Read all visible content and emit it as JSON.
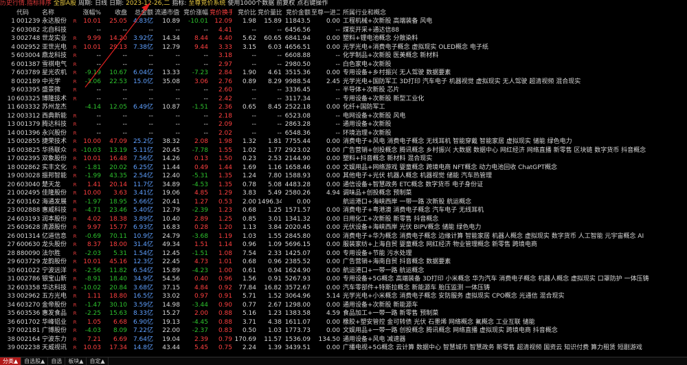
{
  "topbar": {
    "title": "历史行情.指标排序",
    "market": "全部A股",
    "period_label": "周期:",
    "period": "日线",
    "date_label": "日期:",
    "date": "2023-12-26,二",
    "indicator_label": "指标:",
    "indicator": "至尊竞价系统",
    "note1": "使用1000个数据",
    "note2": "前复权",
    "note3": "点右键操作"
  },
  "headers": {
    "code": "代码",
    "name": "名称",
    "chg": "涨幅%",
    "price": "收盘",
    "amt": "总金额",
    "cap": "流通市值亿",
    "bid": "竞价涨幅",
    "turn": "竞价换手↓",
    "ratio": "竞价比",
    "vr": "竞价量比",
    "bidamt": "竞价金额",
    "cont": "至尊一进二",
    "ind": "所属行业和概念"
  },
  "colors": {
    "up": "#ff4040",
    "down": "#2ec22e",
    "neutral": "#d8d8d8",
    "amount": "#5fa0ff",
    "accent": "#e8c840",
    "active_tab": "#b01818"
  },
  "rows": [
    {
      "idx": "1",
      "code": "001239",
      "name": "永达股份",
      "flag": "R",
      "chg": "10.01",
      "price": "25.05",
      "amt": "4.83亿",
      "cap": "10.89",
      "bid": "-10.01",
      "turn": "12.09",
      "ratio": "1.98",
      "vr": "15.89",
      "bidamt": "11843.5",
      "cont": "0.00",
      "ind": "工程机械+次新股 高端装备 风电"
    },
    {
      "idx": "2",
      "code": "603082",
      "name": "北自科技",
      "flag": "",
      "chg": "--",
      "price": "--",
      "amt": "--",
      "cap": "--",
      "bid": "--",
      "turn": "4.41",
      "ratio": "--",
      "vr": "--",
      "bidamt": "6456.56",
      "cont": "--",
      "ind": "煤炭开采+通达信88"
    },
    {
      "idx": "3",
      "code": "002748",
      "name": "世龙实业",
      "flag": "R",
      "chg": "9.99",
      "price": "14.20",
      "amt": "3.92亿",
      "cap": "14.34",
      "bid": "8.44",
      "turn": "4.40",
      "ratio": "5.62",
      "vr": "60.65",
      "bidamt": "6841.94",
      "cont": "0.00",
      "ind": "塑料+锂电池概念 分散染料"
    },
    {
      "idx": "4",
      "code": "002952",
      "name": "亚世光电",
      "flag": "R",
      "chg": "10.01",
      "price": "29.13",
      "amt": "7.38亿",
      "cap": "12.79",
      "bid": "9.44",
      "turn": "3.33",
      "ratio": "3.15",
      "vr": "6.03",
      "bidamt": "4656.51",
      "cont": "0.00",
      "ind": "光学光电+消费电子概念 虚拟现实 OLED概念 电子纸"
    },
    {
      "idx": "5",
      "code": "603004",
      "name": "鼎龙科技",
      "flag": "R",
      "chg": "--",
      "price": "--",
      "amt": "--",
      "cap": "--",
      "bid": "--",
      "turn": "3.18",
      "ratio": "--",
      "vr": "--",
      "bidamt": "6608.88",
      "cont": "--",
      "ind": "化学制品+次新股 医美概念 新材料"
    },
    {
      "idx": "6",
      "code": "001387",
      "name": "雪祺电气",
      "flag": "R",
      "chg": "--",
      "price": "--",
      "amt": "--",
      "cap": "--",
      "bid": "--",
      "turn": "2.97",
      "ratio": "--",
      "vr": "--",
      "bidamt": "2980.50",
      "cont": "--",
      "ind": "白色家电+次新股"
    },
    {
      "idx": "7",
      "code": "603789",
      "name": "星光农机",
      "flag": "R",
      "chg": "-9.19",
      "price": "10.67",
      "amt": "6.04亿",
      "cap": "13.33",
      "bid": "-7.23",
      "turn": "2.84",
      "ratio": "1.90",
      "vr": "4.61",
      "bidamt": "3515.36",
      "cont": "0.00",
      "ind": "专用设备+乡村振兴 无人驾驶 数据要素"
    },
    {
      "idx": "8",
      "code": "002189",
      "name": "中光学",
      "flag": "R",
      "chg": "-3.06",
      "price": "22.53",
      "amt": "15.0亿",
      "cap": "35.08",
      "bid": "3.06",
      "turn": "2.76",
      "ratio": "0.89",
      "vr": "8.29",
      "bidamt": "9988.54",
      "cont": "2.45",
      "ind": "光学光电+国防军工 3D打印 汽车电子 机器视觉 虚拟现实 无人驾驶 超清视频 混合现实"
    },
    {
      "idx": "9",
      "code": "603395",
      "name": "盛景微",
      "flag": "R",
      "chg": "--",
      "price": "--",
      "amt": "--",
      "cap": "--",
      "bid": "--",
      "turn": "2.60",
      "ratio": "--",
      "vr": "--",
      "bidamt": "3336.45",
      "cont": "--",
      "ind": "半导体+次新股 芯片"
    },
    {
      "idx": "10",
      "code": "603325",
      "name": "博隆技术",
      "flag": "R",
      "chg": "--",
      "price": "--",
      "amt": "--",
      "cap": "--",
      "bid": "--",
      "turn": "2.42",
      "ratio": "--",
      "vr": "--",
      "bidamt": "3117.34",
      "cont": "--",
      "ind": "专用设备+次新股 新型工业化"
    },
    {
      "idx": "11",
      "code": "603332",
      "name": "苏州龙杰",
      "flag": "",
      "chg": "-4.14",
      "price": "12.05",
      "amt": "6.49亿",
      "cap": "10.87",
      "bid": "-1.51",
      "turn": "2.36",
      "ratio": "0.65",
      "vr": "8.45",
      "bidamt": "2522.18",
      "cont": "0.00",
      "ind": "化纤+国防军工"
    },
    {
      "idx": "12",
      "code": "003312",
      "name": "西典新能",
      "flag": "R",
      "chg": "--",
      "price": "--",
      "amt": "--",
      "cap": "--",
      "bid": "--",
      "turn": "2.18",
      "ratio": "--",
      "vr": "--",
      "bidamt": "6523.08",
      "cont": "--",
      "ind": "电网设备+次新股 风电"
    },
    {
      "idx": "13",
      "code": "001379",
      "name": "腾达科技",
      "flag": "R",
      "chg": "--",
      "price": "--",
      "amt": "--",
      "cap": "--",
      "bid": "--",
      "turn": "2.09",
      "ratio": "--",
      "vr": "--",
      "bidamt": "2863.28",
      "cont": "--",
      "ind": "通用设备+次新股"
    },
    {
      "idx": "14",
      "code": "001396",
      "name": "永兴股份",
      "flag": "R",
      "chg": "--",
      "price": "--",
      "amt": "--",
      "cap": "--",
      "bid": "--",
      "turn": "2.02",
      "ratio": "--",
      "vr": "--",
      "bidamt": "6548.36",
      "cont": "--",
      "ind": "环境治理+次新股"
    },
    {
      "idx": "15",
      "code": "002855",
      "name": "捷荣技术",
      "flag": "R",
      "chg": "10.00",
      "price": "47.09",
      "amt": "25.2亿",
      "cap": "38.32",
      "bid": "2.08",
      "turn": "1.98",
      "ratio": "1.32",
      "vr": "1.81",
      "bidamt": "7755.44",
      "cont": "0.00",
      "ind": "消费电子+风电 消费电子概念 无线耳机 智能穿戴 智能家居 虚拟现实 储能 绿色电力"
    },
    {
      "idx": "16",
      "code": "003825",
      "name": "华扬联众",
      "flag": "R",
      "chg": "-10.03",
      "price": "13.19",
      "amt": "5.11亿",
      "cap": "20.45",
      "bid": "-7.78",
      "turn": "1.55",
      "ratio": "1.02",
      "vr": "1.77",
      "bidamt": "2923.02",
      "cont": "0.00",
      "ind": "广告营销+创投概念 腾讯概念 乡村振兴 大数据 数据中心 网红经济 网络直播 新零售 区块链 数字货币 抖音概念"
    },
    {
      "idx": "17",
      "code": "002395",
      "name": "双象股份",
      "flag": "R",
      "chg": "10.01",
      "price": "16.48",
      "amt": "7.56亿",
      "cap": "14.26",
      "bid": "0.13",
      "turn": "1.50",
      "ratio": "0.23",
      "vr": "2.53",
      "bidamt": "2144.90",
      "cont": "0.00",
      "ind": "塑料+抖音概念 新材料 混合现实"
    },
    {
      "idx": "18",
      "code": "002862",
      "name": "实丰文化",
      "flag": "R",
      "chg": "-1.81",
      "price": "20.02",
      "amt": "6.25亿",
      "cap": "11.44",
      "bid": "0.49",
      "turn": "1.44",
      "ratio": "1.69",
      "vr": "1.16",
      "bidamt": "1658.46",
      "cont": "0.00",
      "ind": "文娱用品+网络游戏 婴童概念 跨境电商 NFT概念 动力电池回收 ChatGPT概念"
    },
    {
      "idx": "19",
      "code": "003028",
      "name": "振邦智能",
      "flag": "R",
      "chg": "-1.99",
      "price": "43.35",
      "amt": "2.54亿",
      "cap": "12.40",
      "bid": "-5.31",
      "turn": "1.35",
      "ratio": "1.24",
      "vr": "7.80",
      "bidamt": "1588.93",
      "cont": "0.00",
      "ind": "其他电子+光伏 机器人概念 机器视觉 储能 汽车热管理"
    },
    {
      "idx": "20",
      "code": "603040",
      "name": "楚天龙",
      "flag": "R",
      "chg": "1.41",
      "price": "20.14",
      "amt": "11.7亿",
      "cap": "34.89",
      "bid": "-4.53",
      "turn": "1.35",
      "ratio": "0.78",
      "vr": "5.08",
      "bidamt": "4483.28",
      "cont": "0.00",
      "ind": "通信设备+智慧政务 ETC概念 数字货币 电子身份证"
    },
    {
      "idx": "21",
      "code": "002495",
      "name": "佳隆股份",
      "flag": "R",
      "chg": "10.00",
      "price": "3.63",
      "amt": "3.41亿",
      "cap": "19.06",
      "bid": "4.85",
      "turn": "1.29",
      "ratio": "3.83",
      "vr": "5.49",
      "bidamt": "2580.26",
      "cont": "4.94",
      "ind": "调味品+创投概念 预制菜"
    },
    {
      "idx": "22",
      "code": "603162",
      "name": "海通发展",
      "flag": "R",
      "chg": "-1.97",
      "price": "18.95",
      "amt": "5.66亿",
      "cap": "20.41",
      "bid": "1.27",
      "turn": "0.53",
      "ratio": "2.00",
      "vr": "1496.34",
      "bidamt": "0.00",
      "cont": "",
      "ind": "航运港口+海峡西岸 一带一路 次新股 航运概念"
    },
    {
      "idx": "23",
      "code": "002888",
      "name": "惠威科技",
      "flag": "R",
      "chg": "-4.71",
      "price": "23.46",
      "amt": "5.40亿",
      "cap": "12.79",
      "bid": "-2.39",
      "turn": "1.23",
      "ratio": "0.68",
      "vr": "1.25",
      "bidamt": "1571.57",
      "cont": "0.00",
      "ind": "消费电子+粤港澳 消费电子概念 汽车电子 无线耳机"
    },
    {
      "idx": "24",
      "code": "603193",
      "name": "润本股份",
      "flag": "R",
      "chg": "4.02",
      "price": "18.38",
      "amt": "3.89亿",
      "cap": "10.40",
      "bid": "2.89",
      "turn": "1.25",
      "ratio": "0.85",
      "vr": "3.01",
      "bidamt": "1341.32",
      "cont": "0.00",
      "ind": "日用化工+次新股 新零售 抖音概念"
    },
    {
      "idx": "25",
      "code": "603628",
      "name": "清源股份",
      "flag": "R",
      "chg": "9.97",
      "price": "15.77",
      "amt": "6.93亿",
      "cap": "16.83",
      "bid": "0.28",
      "turn": "1.20",
      "ratio": "1.13",
      "vr": "3.84",
      "bidamt": "2020.45",
      "cont": "0.00",
      "ind": "光伏设备+海峡西岸 光伏 BIPV概念 储能 绿色电力"
    },
    {
      "idx": "26",
      "code": "001314",
      "name": "亿道信息",
      "flag": "R",
      "chg": "-0.69",
      "price": "70.11",
      "amt": "10.9亿",
      "cap": "24.79",
      "bid": "-3.68",
      "turn": "1.19",
      "ratio": "1.03",
      "vr": "1.55",
      "bidamt": "2845.80",
      "cont": "0.00",
      "ind": "消费电子+华为概念 消费电子概念 边缘计算 智能家居 机器人概念 虚拟现实 数字货币 人工智能 元宇宙概念 AI"
    },
    {
      "idx": "27",
      "code": "600630",
      "name": "龙头股份",
      "flag": "R",
      "chg": "8.37",
      "price": "18.00",
      "amt": "31.4亿",
      "cap": "49.34",
      "bid": "1.51",
      "turn": "1.14",
      "ratio": "0.96",
      "vr": "1.09",
      "bidamt": "5696.15",
      "cont": "0.00",
      "ind": "服装家纺+上海自贸 婴童概念 网红经济 物业管理概念 新零售 跨境电商"
    },
    {
      "idx": "28",
      "code": "880090",
      "name": "法尔胜",
      "flag": "R",
      "chg": "-2.03",
      "price": "5.31",
      "amt": "1.54亿",
      "cap": "12.45",
      "bid": "-1.51",
      "turn": "1.08",
      "ratio": "7.54",
      "vr": "2.33",
      "bidamt": "1425.07",
      "cont": "0.00",
      "ind": "专用设备+节能 污水处理"
    },
    {
      "idx": "29",
      "code": "603729",
      "name": "龙韵股份",
      "flag": "R",
      "chg": "10.01",
      "price": "45.16",
      "amt": "12.3亿",
      "cap": "22.45",
      "bid": "4.73",
      "turn": "1.01",
      "ratio": "0.68",
      "vr": "0.96",
      "bidamt": "2385.52",
      "cont": "0.00",
      "ind": "广告营销+海南自贸 抖音概念 数据要素"
    },
    {
      "idx": "30",
      "code": "601022",
      "name": "宁波远洋",
      "flag": "R",
      "chg": "-2.56",
      "price": "11.82",
      "amt": "6.54亿",
      "cap": "15.89",
      "bid": "-4.23",
      "turn": "1.00",
      "ratio": "0.61",
      "vr": "0.94",
      "bidamt": "1624.90",
      "cont": "0.00",
      "ind": "航运港口+一带一路 航运概念"
    },
    {
      "idx": "31",
      "code": "002786",
      "name": "银宝山新",
      "flag": "R",
      "chg": "-8.91",
      "price": "18.40",
      "amt": "34.9亿",
      "cap": "54.56",
      "bid": "0.40",
      "turn": "0.96",
      "ratio": "1.56",
      "vr": "0.91",
      "bidamt": "5267.93",
      "cont": "0.00",
      "ind": "专用设备+5G概念 高端装备 3D打印 小米概念 华为汽车 消费电子概念 机器人概念 虚拟现实 口罩防护 一体压铸"
    },
    {
      "idx": "32",
      "code": "603358",
      "name": "华达科技",
      "flag": "R",
      "chg": "-10.02",
      "price": "20.84",
      "amt": "3.68亿",
      "cap": "37.15",
      "bid": "4.84",
      "turn": "0.92",
      "ratio": "77.84",
      "vr": "16.82",
      "bidamt": "3572.67",
      "cont": "0.00",
      "ind": "汽车零部件+特斯拉概念 新能源车 胎压监测 一体压铸"
    },
    {
      "idx": "33",
      "code": "002962",
      "name": "五方光电",
      "flag": "R",
      "chg": "1.11",
      "price": "18.80",
      "amt": "16.5亿",
      "cap": "33.02",
      "bid": "0.97",
      "turn": "0.91",
      "ratio": "5.71",
      "vr": "1.52",
      "bidamt": "3064.96",
      "cont": "5.14",
      "ind": "光学光电+小米概念 消费电子概念 安防服务 虚拟现实 CPO概念 光通信 混合现实"
    },
    {
      "idx": "34",
      "code": "603270",
      "name": "金帝股份",
      "flag": "R",
      "chg": "-1.47",
      "price": "30.10",
      "amt": "3.59亿",
      "cap": "14.98",
      "bid": "-3.44",
      "turn": "0.90",
      "ratio": "0.77",
      "vr": "2.67",
      "bidamt": "1298.00",
      "cont": "0.00",
      "ind": "通用设备+次新股 新能源车"
    },
    {
      "idx": "35",
      "code": "603536",
      "name": "惠发食品",
      "flag": "R",
      "chg": "-2.25",
      "price": "15.63",
      "amt": "8.33亿",
      "cap": "15.27",
      "bid": "2.00",
      "turn": "0.88",
      "ratio": "5.16",
      "vr": "1.23",
      "bidamt": "1383.58",
      "cont": "4.59",
      "ind": "食品加工+一带一路 新零售 预制菜"
    },
    {
      "idx": "36",
      "code": "601702",
      "name": "华峰铝业",
      "flag": "R",
      "chg": "1.05",
      "price": "6.68",
      "amt": "6.90亿",
      "cap": "19.13",
      "bid": "-4.45",
      "turn": "0.88",
      "ratio": "3.71",
      "vr": "4.38",
      "bidamt": "1611.07",
      "cont": "0.00",
      "ind": "橡胶+塑安管控 金可转债 光伏 石墨烯 网络概念 氟概念 工业互联 储能"
    },
    {
      "idx": "37",
      "code": "002181",
      "name": "广博股份",
      "flag": "R",
      "chg": "-4.03",
      "price": "8.09",
      "amt": "7.22亿",
      "cap": "22.00",
      "bid": "-2.37",
      "turn": "0.83",
      "ratio": "0.50",
      "vr": "1.03",
      "bidamt": "1773.73",
      "cont": "0.00",
      "ind": "文娱用品+一带一路 创投概念 腾讯概念 网络直播 虚拟现实 跨境电商 抖音概念"
    },
    {
      "idx": "38",
      "code": "002164",
      "name": "宁波东力",
      "flag": "R",
      "chg": "7.21",
      "price": "6.69",
      "amt": "7.64亿",
      "cap": "19.04",
      "bid": "2.39",
      "turn": "0.79",
      "ratio": "170.69",
      "vr": "11.57",
      "bidamt": "1536.09",
      "cont": "134.50",
      "ind": "通用设备+风电 减速器"
    },
    {
      "idx": "39",
      "code": "002238",
      "name": "天威视讯",
      "flag": "R",
      "chg": "10.03",
      "price": "17.34",
      "amt": "14.8亿",
      "cap": "43.44",
      "bid": "5.45",
      "turn": "0.75",
      "ratio": "2.24",
      "vr": "1.39",
      "bidamt": "3439.51",
      "cont": "0.00",
      "ind": "广播电视+5G概念 云计算 数据中心 智慧城市 智慧政务 新零售 超清视频 国资云 知识付费 算力租赁 短剧游戏"
    }
  ],
  "bottombar": {
    "tabs": [
      "分类▲",
      "自选股▲",
      "自选",
      "板块▲",
      "自定▲"
    ]
  }
}
